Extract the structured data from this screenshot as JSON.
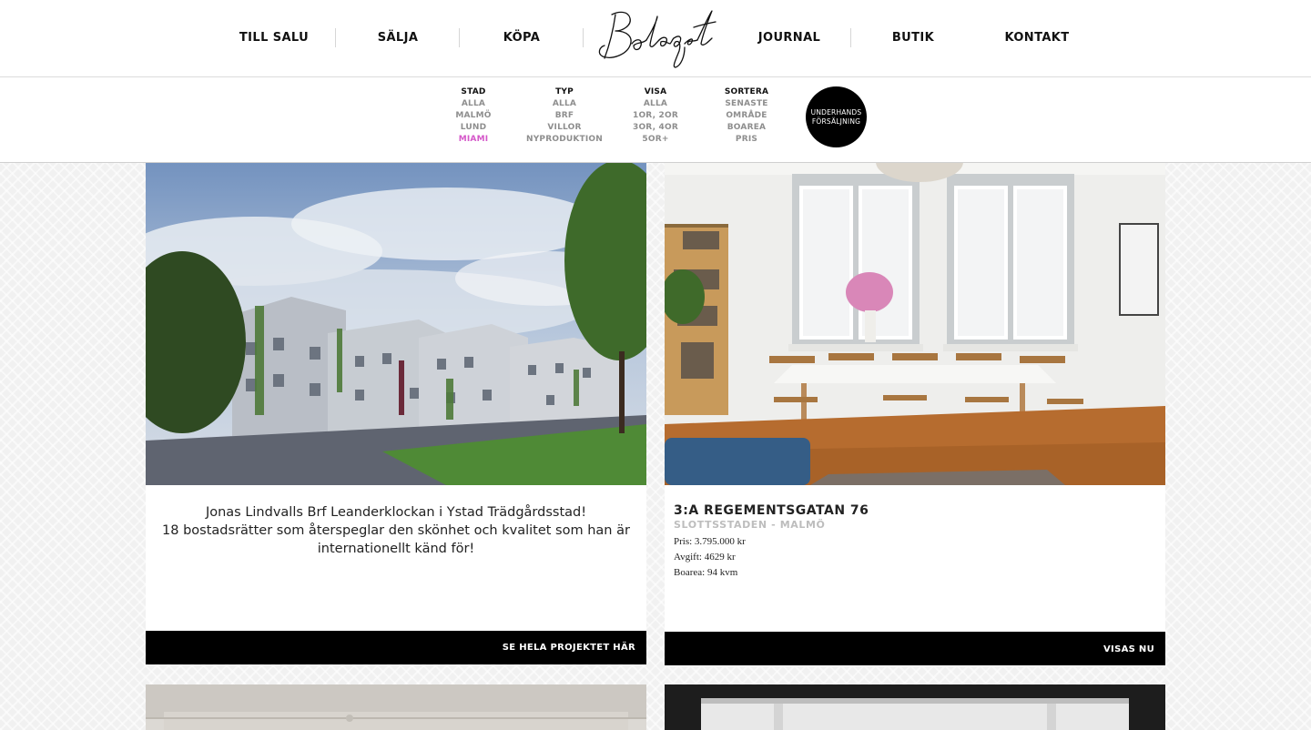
{
  "nav": {
    "left": [
      "TILL SALU",
      "SÄLJA",
      "KÖPA"
    ],
    "right": [
      "JOURNAL",
      "BUTIK",
      "KONTAKT"
    ],
    "logo_text": "Bolaget"
  },
  "filters": [
    {
      "heading": "STAD",
      "options": [
        "ALLA",
        "MALMÖ",
        "LUND",
        "MIAMI"
      ],
      "active": "MIAMI"
    },
    {
      "heading": "TYP",
      "options": [
        "ALLA",
        "BRF",
        "VILLOR",
        "NYPRODUKTION"
      ]
    },
    {
      "heading": "VISA",
      "options": [
        "ALLA",
        "1OR, 2OR",
        "3OR, 4OR",
        "5OR+"
      ]
    },
    {
      "heading": "SORTERA",
      "options": [
        "SENASTE",
        "OMRÅDE",
        "BOAREA",
        "PRIS"
      ]
    }
  ],
  "underhand": {
    "line1": "UNDERHANDS",
    "line2": "FÖRSÄLJNING"
  },
  "cards": {
    "promo": {
      "line1": "Jonas Lindvalls Brf Leanderklockan i Ystad Trädgårdsstad!",
      "line2": "18 bostadsrätter som återspeglar den skönhet och kvalitet som han är",
      "line3": "internationellt känd för!",
      "button": "SE HELA PROJEKTET HÄR"
    },
    "listing": {
      "title": "3:A REGEMENTSGATAN 76",
      "area": "SLOTTSSTADEN - MALMÖ",
      "price": "Pris: 3.795.000 kr",
      "fee": "Avgift: 4629 kr",
      "size": "Boarea: 94 kvm",
      "button": "VISAS NU"
    }
  }
}
